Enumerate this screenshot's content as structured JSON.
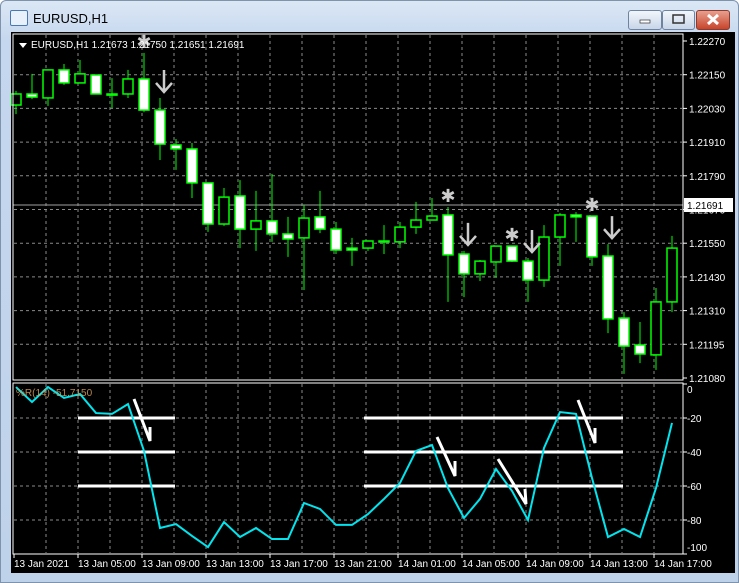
{
  "window": {
    "title": "EURUSD,H1"
  },
  "chart": {
    "header": "EURUSD,H1  1.21673 1.21750 1.21651 1.21691",
    "bid_price": 1.21691,
    "bid_label": "1.21691",
    "price_labels": [
      "1.22270",
      "1.22150",
      "1.22030",
      "1.21910",
      "1.21790",
      "1.21670",
      "1.21550",
      "1.21430",
      "1.21310",
      "1.21195",
      "1.21080"
    ],
    "time_labels": [
      "13 Jan 2021",
      "13 Jan 05:00",
      "13 Jan 09:00",
      "13 Jan 13:00",
      "13 Jan 17:00",
      "13 Jan 21:00",
      "14 Jan 01:00",
      "14 Jan 05:00",
      "14 Jan 09:00",
      "14 Jan 13:00",
      "14 Jan 17:00"
    ],
    "colors": {
      "candle_outline": "#00ff00",
      "bear_fill": "#ffffff",
      "bull_fill": "#000000",
      "wpr_line": "#00e5ee",
      "grid": "#8a8a8a"
    },
    "candles": [
      [
        1.22044,
        1.22094,
        1.22012,
        1.22083
      ],
      [
        1.22083,
        1.22154,
        1.22065,
        1.22072
      ],
      [
        1.22069,
        1.22168,
        1.22041,
        1.22168
      ],
      [
        1.22168,
        1.22189,
        1.22115,
        1.22122
      ],
      [
        1.22122,
        1.22203,
        1.22122,
        1.22154
      ],
      [
        1.2215,
        1.2215,
        1.22083,
        1.22083
      ],
      [
        1.22083,
        1.22139,
        1.22033,
        1.22079
      ],
      [
        1.22083,
        1.22168,
        1.22069,
        1.22136
      ],
      [
        1.22136,
        1.22228,
        1.22019,
        1.22026
      ],
      [
        1.22026,
        1.22069,
        1.2185,
        1.21906
      ],
      [
        1.21903,
        1.21924,
        1.21815,
        1.21889
      ],
      [
        1.21889,
        1.2191,
        1.21716,
        1.21769
      ],
      [
        1.21769,
        1.21769,
        1.21596,
        1.21624
      ],
      [
        1.21624,
        1.21751,
        1.21617,
        1.21719
      ],
      [
        1.21723,
        1.21779,
        1.21539,
        1.21606
      ],
      [
        1.21606,
        1.21741,
        1.21529,
        1.21635
      ],
      [
        1.21635,
        1.21801,
        1.21561,
        1.21589
      ],
      [
        1.21589,
        1.21649,
        1.21508,
        1.21571
      ],
      [
        1.21575,
        1.21691,
        1.21391,
        1.21645
      ],
      [
        1.21649,
        1.21741,
        1.21592,
        1.21606
      ],
      [
        1.21606,
        1.21631,
        1.21518,
        1.21532
      ],
      [
        1.21539,
        1.21575,
        1.21476,
        1.21532
      ],
      [
        1.21539,
        1.21564,
        1.21529,
        1.21564
      ],
      [
        1.21561,
        1.2162,
        1.21518,
        1.21564
      ],
      [
        1.21561,
        1.21631,
        1.21539,
        1.21613
      ],
      [
        1.21613,
        1.21702,
        1.21589,
        1.21638
      ],
      [
        1.21638,
        1.21716,
        1.21638,
        1.21652
      ],
      [
        1.21656,
        1.21684,
        1.21349,
        1.21515
      ],
      [
        1.21518,
        1.21529,
        1.21366,
        1.21448
      ],
      [
        1.21448,
        1.21497,
        1.21423,
        1.21493
      ],
      [
        1.2149,
        1.21546,
        1.21434,
        1.21546
      ],
      [
        1.21546,
        1.21546,
        1.2149,
        1.21493
      ],
      [
        1.21493,
        1.21504,
        1.21349,
        1.21426
      ],
      [
        1.21426,
        1.2162,
        1.21402,
        1.21578
      ],
      [
        1.21578,
        1.21663,
        1.21476,
        1.21656
      ],
      [
        1.21656,
        1.21666,
        1.21561,
        1.21649
      ],
      [
        1.21652,
        1.21652,
        1.21476,
        1.21508
      ],
      [
        1.21511,
        1.21553,
        1.21239,
        1.21289
      ],
      [
        1.21292,
        1.21313,
        1.21095,
        1.21193
      ],
      [
        1.21197,
        1.21278,
        1.21133,
        1.21165
      ],
      [
        1.21162,
        1.21398,
        1.21109,
        1.21349
      ],
      [
        1.21349,
        1.21582,
        1.21313,
        1.21539
      ]
    ],
    "signal_stars_at": [
      8,
      27,
      31,
      36
    ],
    "down_arrows_at": [
      9,
      28,
      32,
      37
    ]
  },
  "indicator": {
    "label": "%R(14) -51.7150",
    "scale_labels": [
      "0",
      "-20",
      "-40",
      "-60",
      "-80",
      "-100"
    ],
    "levels": [
      -20,
      -40,
      -60
    ],
    "values": [
      -1.8,
      -10.6,
      -1.8,
      -8.2,
      -5.9,
      -17.1,
      -17.6,
      -11.8,
      -39.4,
      -84.7,
      -82.4,
      -89.4,
      -95.9,
      -81.2,
      -90,
      -84.7,
      -91.2,
      -91.2,
      -70,
      -73.5,
      -82.9,
      -82.9,
      -76.5,
      -67.6,
      -58.2,
      -39.4,
      -35.9,
      -61.2,
      -78.8,
      -67.6,
      -50,
      -62.9,
      -80,
      -37.6,
      -16.5,
      -17.6,
      -55.3,
      -90,
      -85.3,
      -90,
      -61.2,
      -22.9
    ]
  }
}
